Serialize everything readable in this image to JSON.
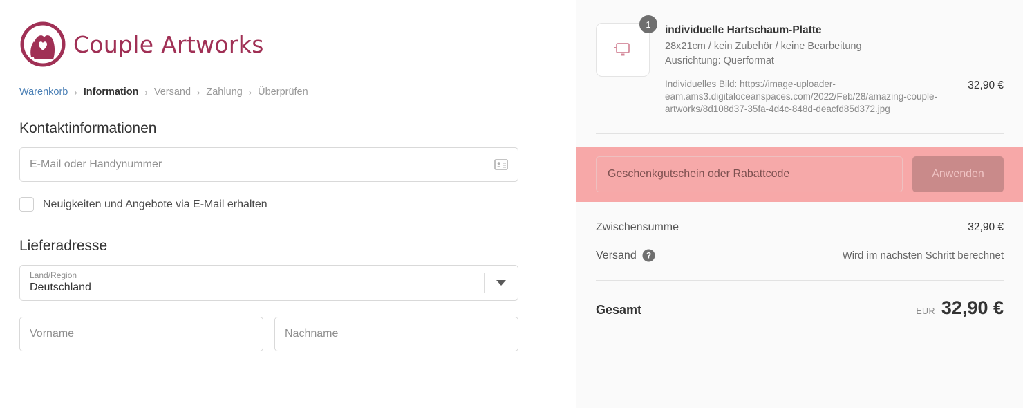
{
  "brand": {
    "name": "Couple Artworks",
    "logo_color": "#a03055",
    "logo_icon": "couple-heart-logo"
  },
  "breadcrumb": {
    "items": [
      {
        "label": "Warenkorb",
        "state": "link"
      },
      {
        "label": "Information",
        "state": "current"
      },
      {
        "label": "Versand",
        "state": "muted"
      },
      {
        "label": "Zahlung",
        "state": "muted"
      },
      {
        "label": "Überprüfen",
        "state": "muted"
      }
    ],
    "separator": "›"
  },
  "contact": {
    "heading": "Kontaktinformationen",
    "email_placeholder": "E-Mail oder Handynummer",
    "email_value": "",
    "email_icon": "contact-card-icon",
    "newsletter_label": "Neuigkeiten und Angebote via E-Mail erhalten",
    "newsletter_checked": false
  },
  "shipping_address": {
    "heading": "Lieferadresse",
    "country_label": "Land/Region",
    "country_value": "Deutschland",
    "country_caret_icon": "chevron-down-icon",
    "first_name_placeholder": "Vorname",
    "first_name_value": "",
    "last_name_placeholder": "Nachname",
    "last_name_value": ""
  },
  "order_summary": {
    "item": {
      "quantity": "1",
      "title": "individuelle Hartschaum-Platte",
      "variant": "28x21cm / kein Zubehör / keine Bearbeitung",
      "orientation": "Ausrichtung: Querformat",
      "custom_image": "Individuelles Bild: https://image-uploader-eam.ams3.digitaloceanspaces.com/2022/Feb/28/amazing-couple-artworks/8d108d37-35fa-4d4c-848d-deacfd85d372.jpg",
      "price": "32,90 €",
      "thumb_icon": "monitor-icon"
    },
    "discount": {
      "placeholder": "Geschenkgutschein oder Rabattcode",
      "value": "",
      "apply_label": "Anwenden",
      "highlight_color": "#f7a8a8",
      "button_color": "#c98a8a"
    },
    "subtotal_label": "Zwischensumme",
    "subtotal_value": "32,90 €",
    "shipping_label": "Versand",
    "shipping_help_icon": "help-circle-icon",
    "shipping_value": "Wird im nächsten Schritt berechnet",
    "total_label": "Gesamt",
    "total_currency": "EUR",
    "total_value": "32,90 €"
  }
}
